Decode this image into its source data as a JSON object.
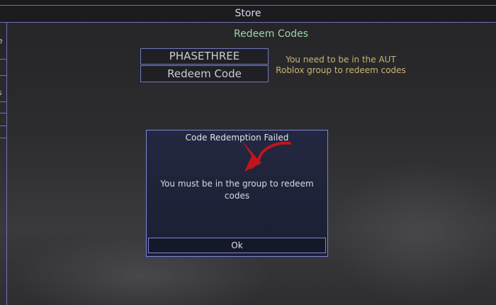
{
  "store": {
    "title": "Store"
  },
  "side_panel": {
    "fragments": [
      "e",
      "s"
    ]
  },
  "redeem": {
    "title": "Redeem Codes",
    "code_value": "PHASETHREE",
    "button_label": "Redeem Code",
    "notice_line1": "You need to be in the AUT",
    "notice_line2": "Roblox group to redeem codes"
  },
  "dialog": {
    "title": "Code Redemption Failed",
    "message_line1": "You must be in the group to redeem",
    "message_line2": "codes",
    "ok_label": "Ok"
  },
  "colors": {
    "accent_border": "#6e72b8",
    "redeem_title": "#9fd3a4",
    "notice_text": "#c9b473",
    "annotation_arrow": "#c0151c"
  }
}
